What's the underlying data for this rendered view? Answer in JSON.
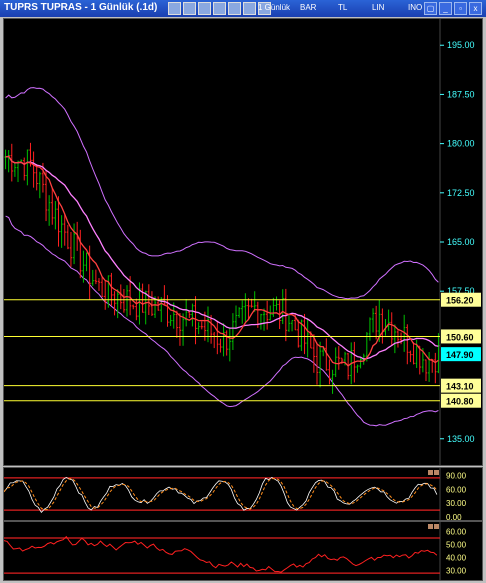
{
  "window": {
    "title": "TUPRS TUPRAS - 1 Günlük (.1d)",
    "menu": [
      "1 Günlük",
      "BAR",
      "TL",
      "LIN",
      "INO"
    ],
    "buttons": [
      "▢",
      "_",
      "▫",
      "x"
    ]
  },
  "main": {
    "y_min": 131,
    "y_max": 199,
    "ticks": [
      "195.00",
      "187.50",
      "180.00",
      "172.50",
      "165.00",
      "157.50",
      "135.00"
    ],
    "tick_values": [
      195,
      187.5,
      180,
      172.5,
      165,
      157.5,
      135
    ],
    "hlines": [
      {
        "value": 156.2,
        "label": "156.20",
        "color": "#ffff33"
      },
      {
        "value": 150.6,
        "label": "150.60",
        "color": "#ffff33"
      },
      {
        "value": 143.1,
        "label": "143.10",
        "color": "#ffff33"
      },
      {
        "value": 140.8,
        "label": "140.80",
        "color": "#ffff33"
      }
    ],
    "last_price": {
      "value": 147.9,
      "label": "147.90",
      "color": "#00ffff"
    },
    "colors": {
      "bull": "#00c000",
      "bear": "#ff2020",
      "ma1": "#ff4040",
      "ma2": "#ff80ff",
      "bands": "#d070ff"
    }
  },
  "osc1": {
    "ticks": [
      "90.00",
      "60.00",
      "30.00",
      "0.00"
    ],
    "tick_values": [
      90,
      60,
      30,
      0
    ],
    "lines": [
      85,
      15
    ]
  },
  "osc2": {
    "ticks": [
      "60.00",
      "50.00",
      "40.00",
      "30.00"
    ],
    "tick_values": [
      60,
      50,
      40,
      30
    ],
    "lines": [
      55,
      28
    ]
  }
}
